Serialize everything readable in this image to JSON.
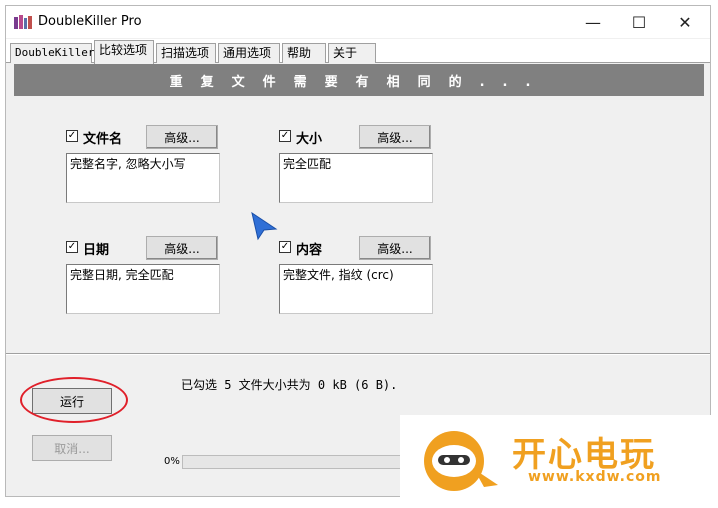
{
  "window": {
    "title": "DoubleKiller Pro",
    "minimize_glyph": "—",
    "maximize_glyph": "☐",
    "close_glyph": "✕"
  },
  "tabs": [
    {
      "label": "DoubleKiller"
    },
    {
      "label": "比较选项"
    },
    {
      "label": "扫描选项"
    },
    {
      "label": "通用选项"
    },
    {
      "label": "帮助"
    },
    {
      "label": "关于"
    }
  ],
  "active_tab": "比较选项",
  "banner": "重复文件需要有相同的...",
  "criteria": {
    "filename": {
      "label": "文件名",
      "checked": "✓",
      "advanced": "高级...",
      "description": "完整名字, 忽略大小写"
    },
    "size": {
      "label": "大小",
      "checked": "✓",
      "advanced": "高级...",
      "description": "完全匹配"
    },
    "date": {
      "label": "日期",
      "checked": "✓",
      "advanced": "高级...",
      "description": "完整日期, 完全匹配"
    },
    "content": {
      "label": "内容",
      "checked": "✓",
      "advanced": "高级...",
      "description": "完整文件, 指纹 (crc)"
    }
  },
  "actions": {
    "run": "运行",
    "cancel": "取消..."
  },
  "status": "已勾选 5 文件大小共为 0 kB (6 B).",
  "progress": {
    "label": "0%",
    "value": 0
  },
  "watermark": {
    "text": "开心电玩",
    "url": "www.kxdw.com"
  },
  "colors": {
    "banner": "#808080",
    "annotation": "#e0202a",
    "cursor": "#2f6fd6",
    "watermark": "#f0a020"
  }
}
